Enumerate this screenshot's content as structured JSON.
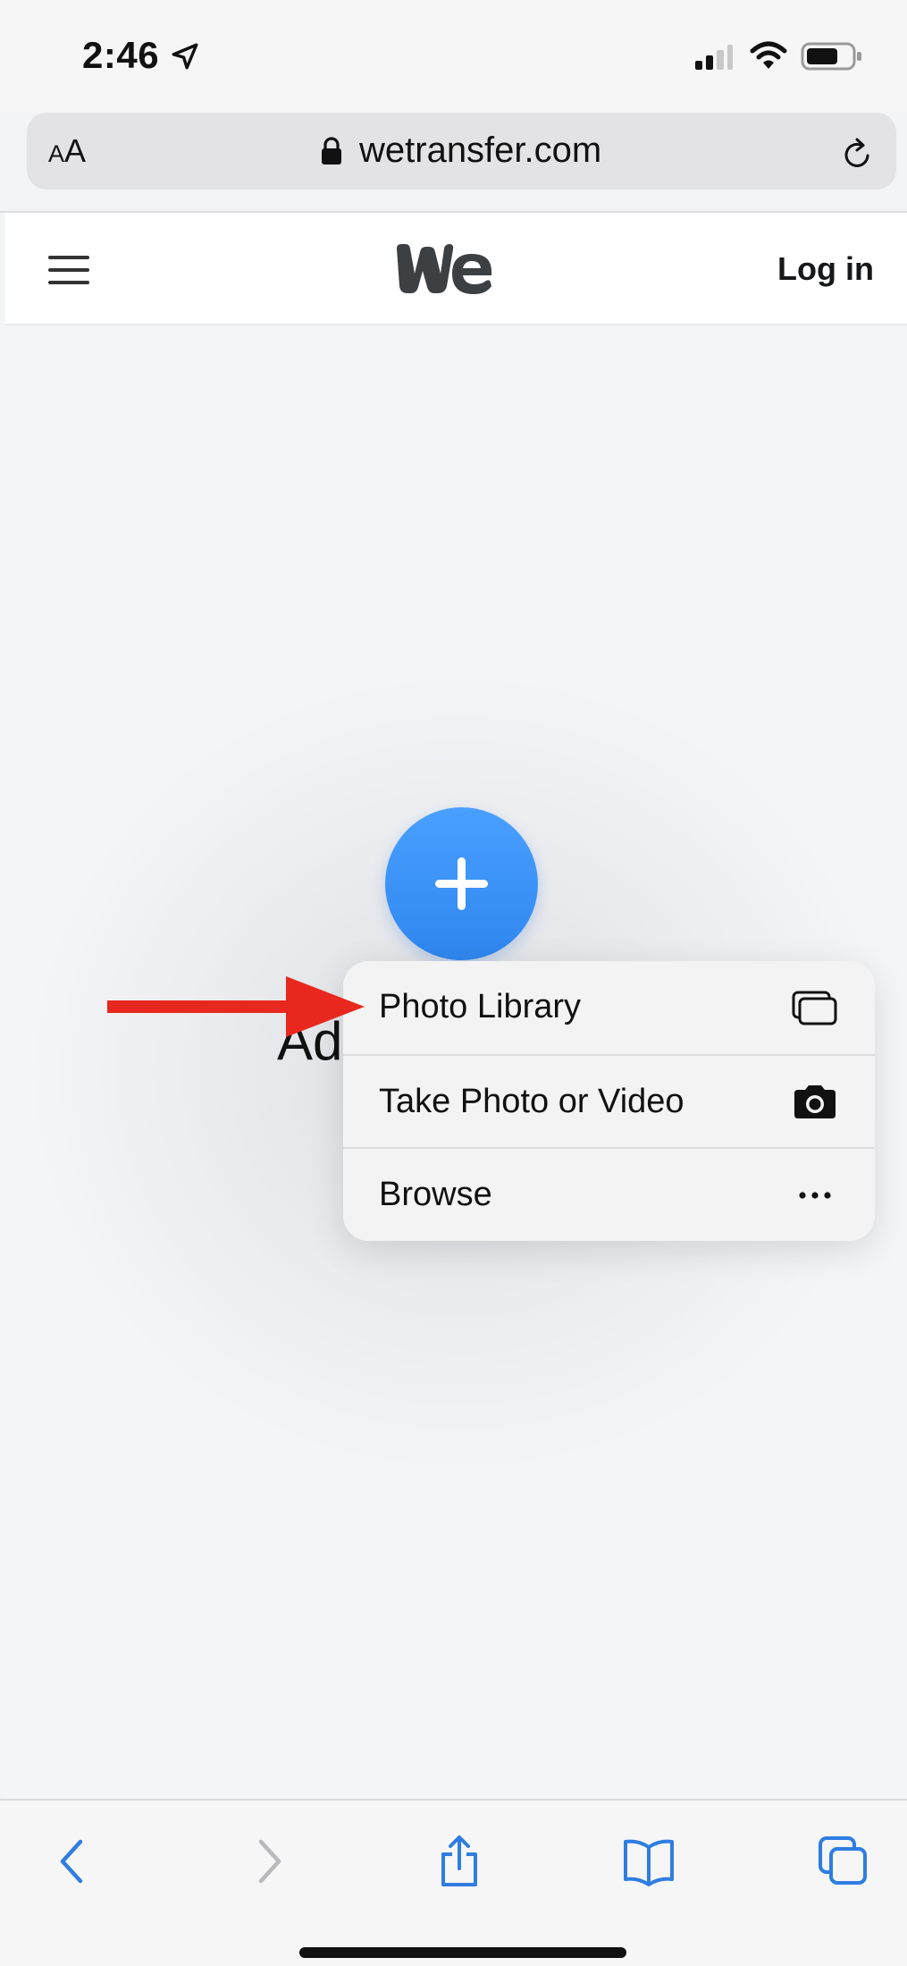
{
  "status_bar": {
    "time": "2:46",
    "icons": [
      "location-arrow-icon",
      "signal-icon",
      "wifi-icon",
      "battery-icon"
    ]
  },
  "address_bar": {
    "text_size_label_small": "A",
    "text_size_label_large": "A",
    "url": "wetransfer.com",
    "icons": [
      "lock-icon",
      "reload-icon"
    ]
  },
  "site_header": {
    "menu_icon": "hamburger-menu-icon",
    "logo_icon": "wetransfer-we-logo",
    "login_label": "Log in"
  },
  "main": {
    "add_button_icon": "plus-icon",
    "partial_title": "Ad"
  },
  "popup_menu": {
    "items": [
      {
        "label": "Photo Library",
        "icon": "photo-library-icon"
      },
      {
        "label": "Take Photo or Video",
        "icon": "camera-icon"
      },
      {
        "label": "Browse",
        "icon": "more-ellipsis-icon"
      }
    ]
  },
  "annotation": {
    "icon": "red-arrow-annotation",
    "color": "#e8281e"
  },
  "toolbar": {
    "icons": [
      "back-icon",
      "forward-icon",
      "share-icon",
      "bookmarks-icon",
      "tabs-icon"
    ],
    "accent_color": "#2f7de1",
    "disabled_color": "#b9b9bd"
  }
}
